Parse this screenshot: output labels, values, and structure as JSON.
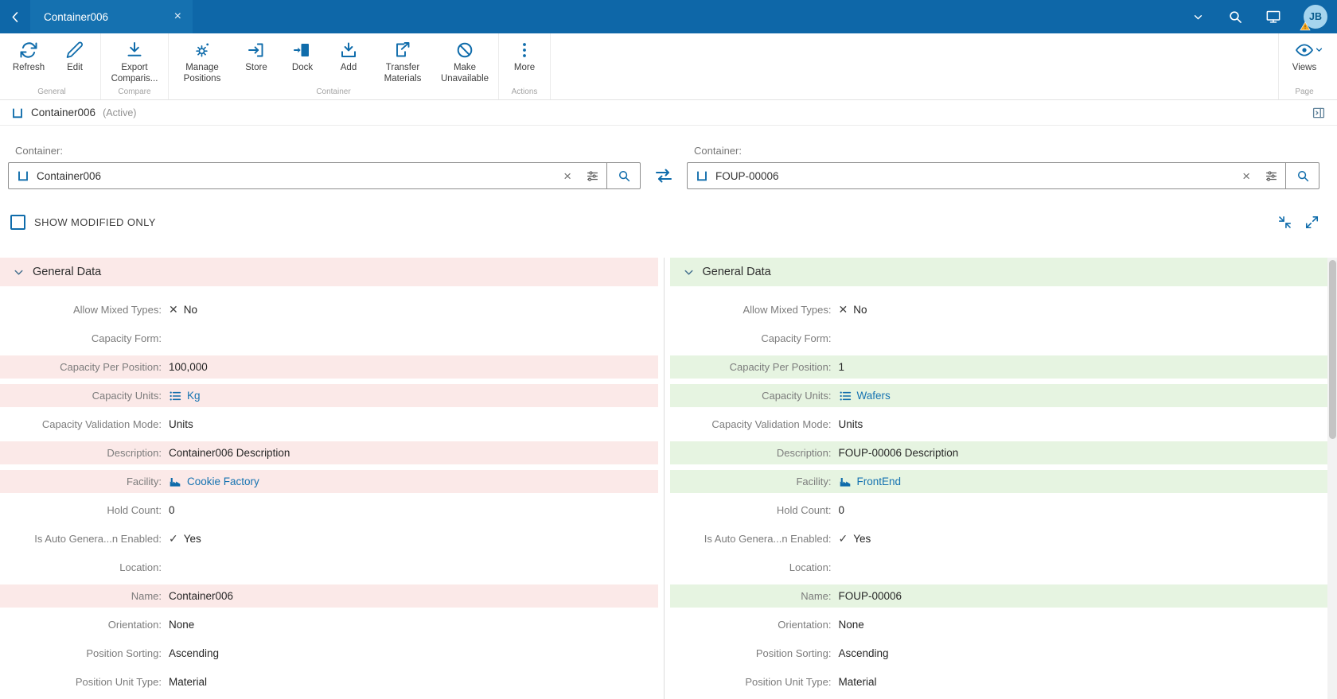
{
  "colors": {
    "topbar_blue": "#0e67a8",
    "icon_blue": "#0f6cab",
    "link_blue": "#1673b1",
    "removed_bg": "#fbe9e8",
    "added_bg": "#e6f4e1"
  },
  "topbar": {
    "tab": {
      "title": "Container006"
    },
    "avatar": {
      "initials": "JB"
    }
  },
  "toolbar": {
    "groups": [
      {
        "label": "General",
        "buttons": [
          {
            "label": "Refresh",
            "icon": "refresh-icon"
          },
          {
            "label": "Edit",
            "icon": "edit-icon"
          }
        ]
      },
      {
        "label": "Compare",
        "buttons": [
          {
            "label": "Export Comparis...",
            "icon": "export-comparison-icon"
          }
        ]
      },
      {
        "label": "Container",
        "buttons": [
          {
            "label": "Manage Positions",
            "icon": "manage-positions-icon"
          },
          {
            "label": "Store",
            "icon": "store-icon"
          },
          {
            "label": "Dock",
            "icon": "dock-icon"
          },
          {
            "label": "Add",
            "icon": "add-icon"
          },
          {
            "label": "Transfer Materials",
            "icon": "transfer-materials-icon"
          },
          {
            "label": "Make Unavailable",
            "icon": "make-unavailable-icon"
          }
        ]
      },
      {
        "label": "Actions",
        "buttons": [
          {
            "label": "More",
            "icon": "more-icon"
          }
        ]
      }
    ],
    "page_group": {
      "label": "Page",
      "buttons": [
        {
          "label": "Views",
          "icon": "views-icon",
          "dropdown": true
        }
      ]
    }
  },
  "titlebar": {
    "title": "Container006",
    "status": "(Active)"
  },
  "compare": {
    "left": {
      "label": "Container:",
      "value": "Container006"
    },
    "right": {
      "label": "Container:",
      "value": "FOUP-00006"
    }
  },
  "filter": {
    "show_modified_only_label": "SHOW MODIFIED ONLY",
    "checked": false
  },
  "panels": [
    {
      "side": "left",
      "accent": "removed",
      "section_title": "General Data",
      "fields": [
        {
          "label": "Allow Mixed Types:",
          "value": "No",
          "prefix": "cross",
          "highlight": false
        },
        {
          "label": "Capacity Form:",
          "value": "",
          "highlight": false
        },
        {
          "label": "Capacity Per Position:",
          "value": "100,000",
          "highlight": true
        },
        {
          "label": "Capacity Units:",
          "value": "Kg",
          "link": true,
          "value_icon": "list-icon",
          "highlight": true
        },
        {
          "label": "Capacity Validation Mode:",
          "value": "Units",
          "highlight": false
        },
        {
          "label": "Description:",
          "value": "Container006 Description",
          "highlight": true
        },
        {
          "label": "Facility:",
          "value": "Cookie Factory",
          "link": true,
          "value_icon": "facility-icon",
          "highlight": true
        },
        {
          "label": "Hold Count:",
          "value": "0",
          "highlight": false
        },
        {
          "label": "Is Auto Genera...n Enabled:",
          "value": "Yes",
          "prefix": "check",
          "highlight": false
        },
        {
          "label": "Location:",
          "value": "",
          "highlight": false
        },
        {
          "label": "Name:",
          "value": "Container006",
          "highlight": true
        },
        {
          "label": "Orientation:",
          "value": "None",
          "highlight": false
        },
        {
          "label": "Position Sorting:",
          "value": "Ascending",
          "highlight": false
        },
        {
          "label": "Position Unit Type:",
          "value": "Material",
          "highlight": false
        }
      ]
    },
    {
      "side": "right",
      "accent": "added",
      "section_title": "General Data",
      "fields": [
        {
          "label": "Allow Mixed Types:",
          "value": "No",
          "prefix": "cross",
          "highlight": false
        },
        {
          "label": "Capacity Form:",
          "value": "",
          "highlight": false
        },
        {
          "label": "Capacity Per Position:",
          "value": "1",
          "highlight": true
        },
        {
          "label": "Capacity Units:",
          "value": "Wafers",
          "link": true,
          "value_icon": "list-icon",
          "highlight": true
        },
        {
          "label": "Capacity Validation Mode:",
          "value": "Units",
          "highlight": false
        },
        {
          "label": "Description:",
          "value": "FOUP-00006 Description",
          "highlight": true
        },
        {
          "label": "Facility:",
          "value": "FrontEnd",
          "link": true,
          "value_icon": "facility-icon",
          "highlight": true
        },
        {
          "label": "Hold Count:",
          "value": "0",
          "highlight": false
        },
        {
          "label": "Is Auto Genera...n Enabled:",
          "value": "Yes",
          "prefix": "check",
          "highlight": false
        },
        {
          "label": "Location:",
          "value": "",
          "highlight": false
        },
        {
          "label": "Name:",
          "value": "FOUP-00006",
          "highlight": true
        },
        {
          "label": "Orientation:",
          "value": "None",
          "highlight": false
        },
        {
          "label": "Position Sorting:",
          "value": "Ascending",
          "highlight": false
        },
        {
          "label": "Position Unit Type:",
          "value": "Material",
          "highlight": false
        }
      ]
    }
  ]
}
